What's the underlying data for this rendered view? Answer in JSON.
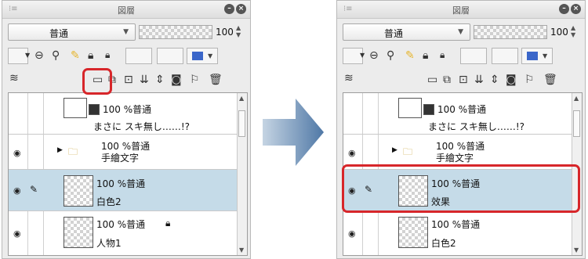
{
  "panel_title": "図層",
  "blend_mode": "普通",
  "opacity_value": "100",
  "colors": {
    "selection": "#c5dbe8",
    "highlight": "#d7262a",
    "arrow": "#6b8fb3"
  },
  "icons": {
    "toolbar_row1": [
      "palette-color-icon",
      "mask-icon",
      "ruler-icon",
      "pencil-icon",
      "lock-icon",
      "lock-transparent-icon",
      "reference-icon",
      "draft-icon",
      "layer-color-icon"
    ],
    "toolbar_row2": [
      "stack-icon",
      "new-raster-layer-icon",
      "new-vector-layer-icon",
      "new-folder-icon",
      "merge-down-icon",
      "merge-icon",
      "mask-create-icon",
      "ruler-create-icon",
      "trash-icon"
    ]
  },
  "left_panel": {
    "layers": [
      {
        "opacity_mode": "100 %普通",
        "name": "まさに スキ無し……!?"
      },
      {
        "opacity_mode": "100 %普通",
        "name": "手繪文字"
      },
      {
        "opacity_mode": "100 %普通",
        "name": "白色2"
      },
      {
        "opacity_mode": "100 %普通",
        "name": "人物1"
      }
    ]
  },
  "right_panel": {
    "layers": [
      {
        "opacity_mode": "100 %普通",
        "name": "まさに スキ無し……!?"
      },
      {
        "opacity_mode": "100 %普通",
        "name": "手繪文字"
      },
      {
        "opacity_mode": "100 %普通",
        "name": "效果"
      },
      {
        "opacity_mode": "100 %普通",
        "name": "白色2"
      }
    ]
  }
}
